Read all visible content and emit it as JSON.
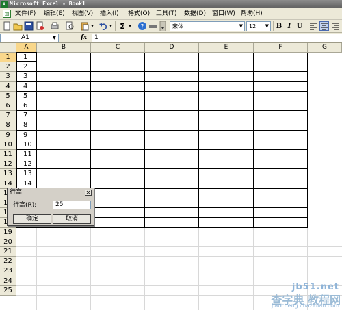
{
  "window": {
    "title": "Microsoft Excel - Book1",
    "app_icon": "excel-icon"
  },
  "menubar": {
    "items": [
      {
        "label": "文件(F)"
      },
      {
        "label": "编辑(E)"
      },
      {
        "label": "视图(V)"
      },
      {
        "label": "插入(I)"
      },
      {
        "label": "格式(O)"
      },
      {
        "label": "工具(T)"
      },
      {
        "label": "数据(D)"
      },
      {
        "label": "窗口(W)"
      },
      {
        "label": "帮助(H)"
      }
    ]
  },
  "toolbar": {
    "sum_symbol": "Σ",
    "font_name": "宋体",
    "font_size": "12",
    "bold": "B",
    "italic": "I",
    "underline": "U"
  },
  "formula_bar": {
    "name_box": "A1",
    "fx": "fx",
    "value": "1"
  },
  "sheet": {
    "columns": [
      "A",
      "B",
      "C",
      "D",
      "E",
      "F",
      "G"
    ],
    "rows": [
      "1",
      "2",
      "3",
      "4",
      "5",
      "6",
      "7",
      "8",
      "9",
      "10",
      "11",
      "12",
      "13",
      "14",
      "15",
      "16",
      "17",
      "18",
      "19",
      "20",
      "21",
      "22",
      "23",
      "24",
      "25"
    ],
    "col_a_values": [
      "1",
      "2",
      "3",
      "4",
      "5",
      "6",
      "7",
      "8",
      "9",
      "10",
      "11",
      "12",
      "13",
      "14"
    ]
  },
  "dialog": {
    "title": "行高",
    "label": "行高(R):",
    "value": "25",
    "ok_label": "确定",
    "cancel_label": "取消",
    "close_symbol": "✕"
  },
  "watermark": {
    "line1": "jb51.net",
    "line2": "查字典 教程网",
    "line3": "jiaocheng.chazidian.com"
  },
  "colors": {
    "chrome": "#ece9d8",
    "title_bar": "#6f6f6f",
    "grid_line": "#000000",
    "excel_green": "#1f7a2e"
  }
}
